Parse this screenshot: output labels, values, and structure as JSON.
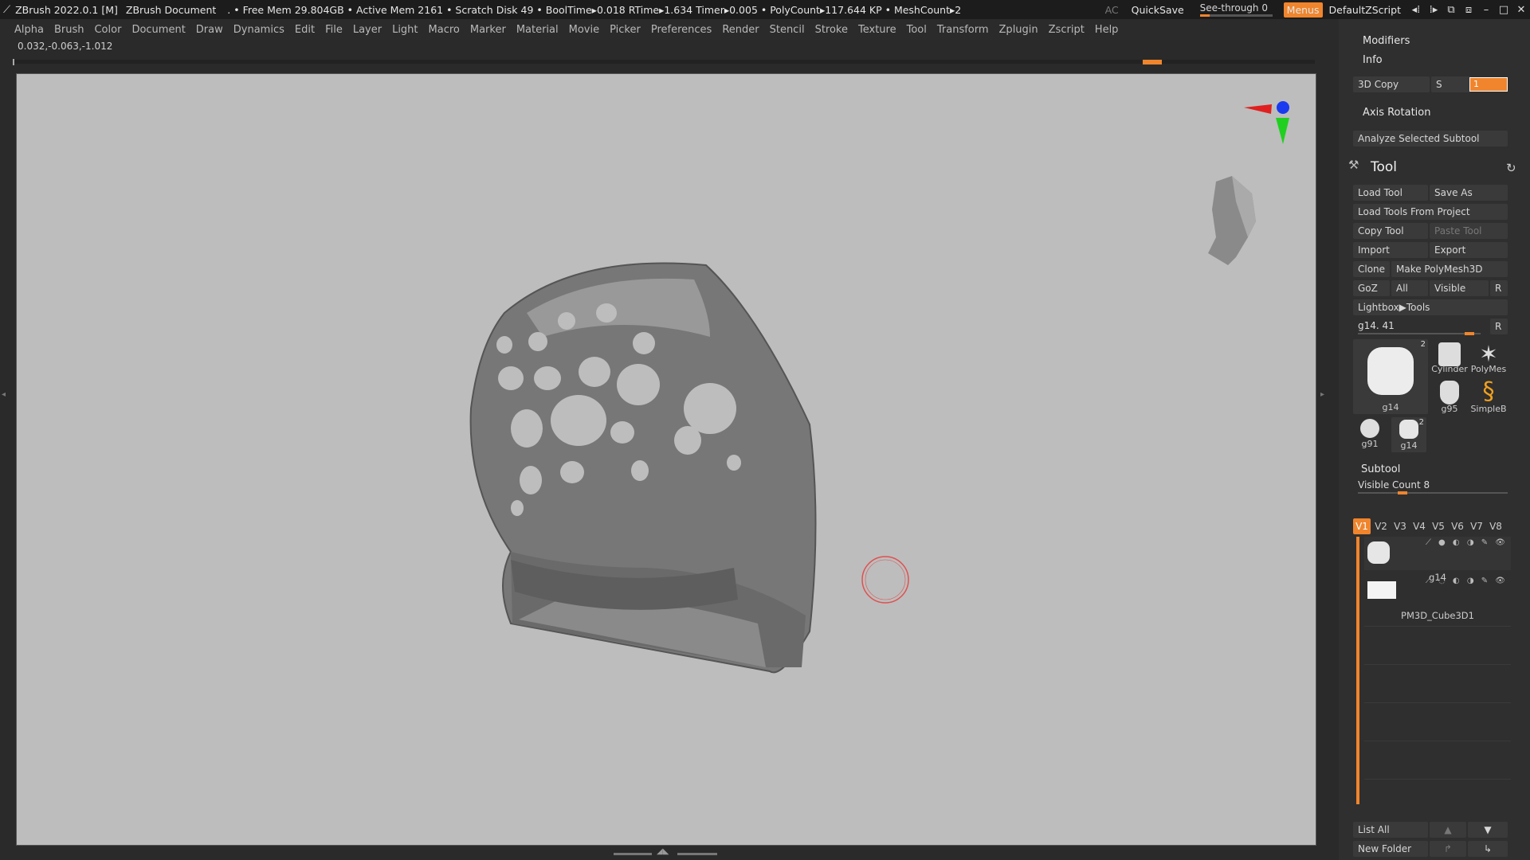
{
  "titlebar": {
    "app_title": "ZBrush 2022.0.1 [M]",
    "document": "ZBrush Document",
    "stats": ". • Free Mem 29.804GB • Active Mem 2161 • Scratch Disk 49 • BoolTime▸0.018 RTime▸1.634 Timer▸0.005 • PolyCount▸117.644 KP • MeshCount▸2",
    "ac": "AC",
    "quicksave": "QuickSave",
    "seethrough_label": "See-through",
    "seethrough_value": "0",
    "menus": "Menus",
    "zscript": "DefaultZScript",
    "accent": "#f0852d"
  },
  "menubar": [
    "Alpha",
    "Brush",
    "Color",
    "Document",
    "Draw",
    "Dynamics",
    "Edit",
    "File",
    "Layer",
    "Light",
    "Macro",
    "Marker",
    "Material",
    "Movie",
    "Picker",
    "Preferences",
    "Render",
    "Stencil",
    "Stroke",
    "Texture",
    "Tool",
    "Transform",
    "Zplugin",
    "Zscript",
    "Help"
  ],
  "coords": "0.032,-0.063,-1.012",
  "panel": {
    "modifiers": "Modifiers",
    "info": "Info",
    "copy3d": "3D Copy",
    "s": "S",
    "s_value": "1",
    "axis_rotation": "Axis Rotation",
    "analyze": "Analyze Selected Subtool",
    "tool_title": "Tool",
    "load_tool": "Load Tool",
    "save_as": "Save As",
    "load_from_project": "Load Tools From Project",
    "copy_tool": "Copy Tool",
    "paste_tool": "Paste Tool",
    "import": "Import",
    "export": "Export",
    "clone": "Clone",
    "make_polymesh": "Make PolyMesh3D",
    "goz": "GoZ",
    "all": "All",
    "visible": "Visible",
    "r": "R",
    "lightbox": "Lightbox▶Tools",
    "tool_slider": "g14. 41",
    "thumbs": [
      {
        "caption": "g14",
        "count": "2"
      },
      {
        "caption": "Cylinder",
        "count": ""
      },
      {
        "caption": "PolyMes",
        "count": ""
      },
      {
        "caption": "g95",
        "count": ""
      },
      {
        "caption": "SimpleB",
        "count": ""
      },
      {
        "caption": "g91",
        "count": ""
      },
      {
        "caption": "g14",
        "count": "2"
      }
    ],
    "subtool_title": "Subtool",
    "visible_count": "Visible Count 8",
    "vtabs": [
      "V1",
      "V2",
      "V3",
      "V4",
      "V5",
      "V6",
      "V7",
      "V8"
    ],
    "subtools": [
      "g14",
      "PM3D_Cube3D1"
    ],
    "list_all": "List All",
    "new_folder": "New Folder"
  }
}
